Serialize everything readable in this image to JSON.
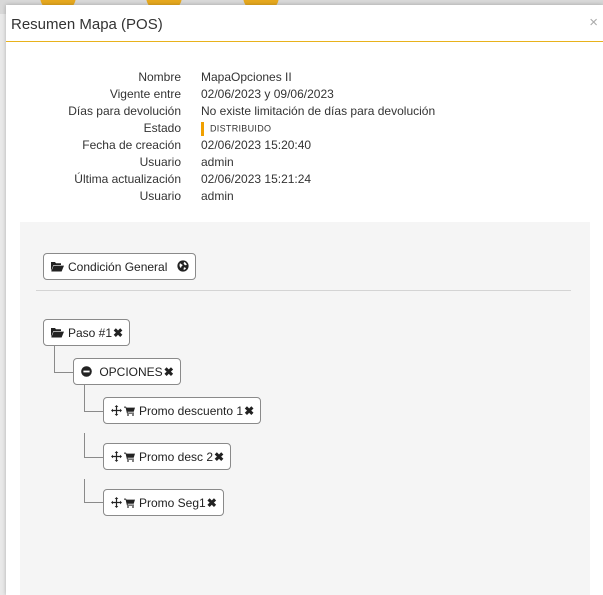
{
  "modal": {
    "title": "Resumen Mapa (POS)",
    "close": "×"
  },
  "info": [
    {
      "label": "Nombre",
      "value": "MapaOpciones II"
    },
    {
      "label": "Vigente entre",
      "value": "02/06/2023 y 09/06/2023"
    },
    {
      "label": "Días para devolución",
      "value": "No existe limitación de días para devolución"
    },
    {
      "label": "Estado",
      "value": "DISTRIBUIDO"
    },
    {
      "label": "Fecha de creación",
      "value": "02/06/2023 15:20:40"
    },
    {
      "label": "Usuario",
      "value": "admin"
    },
    {
      "label": "Última actualización",
      "value": "02/06/2023 15:21:24"
    },
    {
      "label": "Usuario",
      "value": "admin"
    }
  ],
  "tree": {
    "general": {
      "label": "Condición General",
      "icon": "folder-open-icon",
      "trailing_icon": "globe-icon"
    },
    "paso": {
      "label": "Paso #1",
      "icon": "folder-open-icon"
    },
    "opciones": {
      "label": "OPCIONES",
      "icon": "minus-circle-icon"
    },
    "promos": [
      {
        "label": "Promo descuento 1"
      },
      {
        "label": "Promo desc 2"
      },
      {
        "label": "Promo Seg1"
      }
    ],
    "remove_glyph": "✖"
  },
  "colors": {
    "accent": "#e8b21c",
    "estado": "#f0a000"
  }
}
